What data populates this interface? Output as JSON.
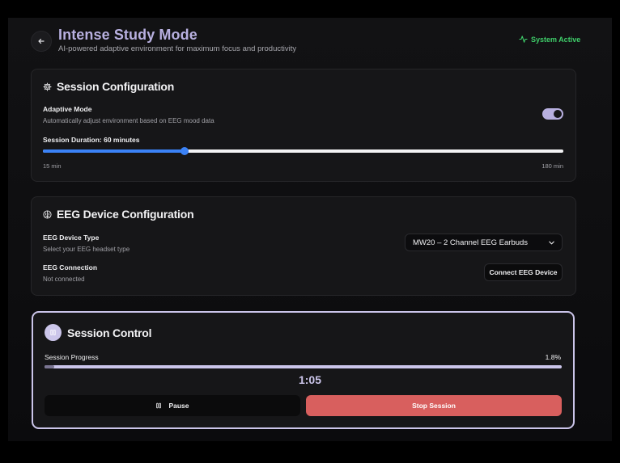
{
  "header": {
    "title": "Intense Study Mode",
    "subtitle": "AI-powered adaptive environment for maximum focus and productivity",
    "status": "System Active",
    "status_color": "#3fce6a"
  },
  "session_config": {
    "title": "Session Configuration",
    "adaptive_label": "Adaptive Mode",
    "adaptive_desc": "Automatically adjust environment based on EEG mood data",
    "adaptive_enabled": true,
    "duration_label": "Session Duration: 60 minutes",
    "duration_min_label": "15 min",
    "duration_max_label": "180 min",
    "duration_value": 60,
    "duration_min": 15,
    "duration_max": 180
  },
  "eeg_config": {
    "title": "EEG Device Configuration",
    "device_type_label": "EEG Device Type",
    "device_type_desc": "Select your EEG headset type",
    "device_selected": "MW20 – 2 Channel EEG Earbuds",
    "connection_label": "EEG Connection",
    "connection_status": "Not connected",
    "connect_button": "Connect EEG Device"
  },
  "session_control": {
    "title": "Session Control",
    "progress_label": "Session Progress",
    "progress_text": "1.8%",
    "progress_value": 0.018,
    "timer": "1:05",
    "pause_label": "Pause",
    "stop_label": "Stop Session",
    "accent_color": "#cbc5ea",
    "stop_color": "#d85f5e"
  },
  "icons": {
    "back": "arrow-left-icon",
    "status": "activity-icon",
    "settings": "gear-icon",
    "eeg": "brain-icon",
    "session": "pause-icon",
    "select": "chevron-down-icon"
  }
}
